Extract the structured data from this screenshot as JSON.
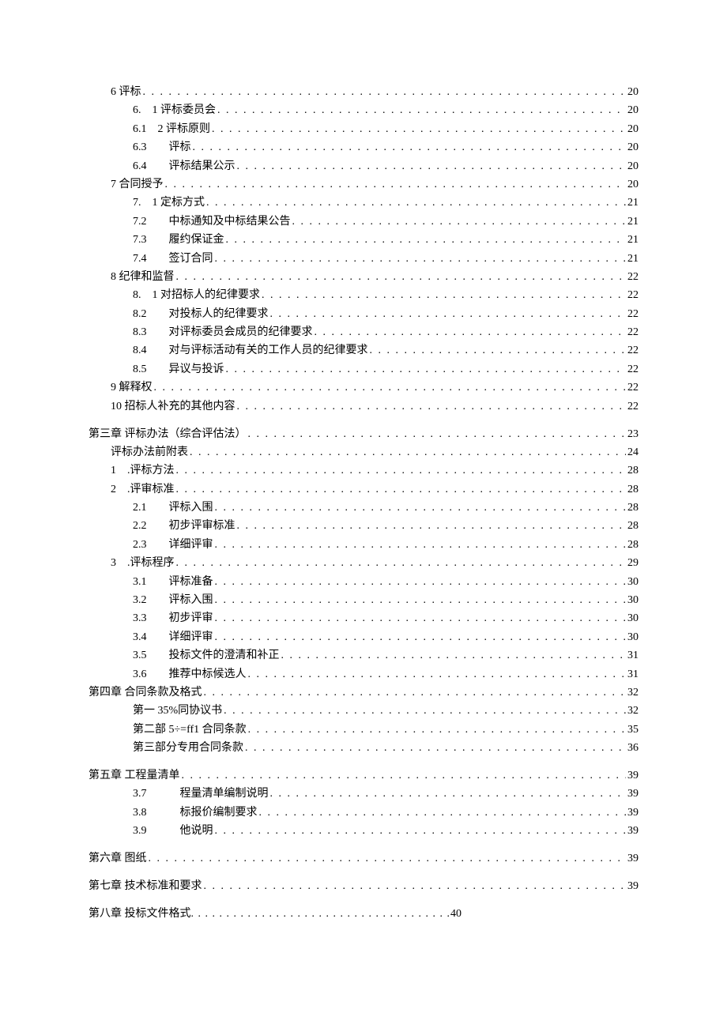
{
  "entries": [
    {
      "level": 2,
      "label": "6 评标",
      "page": "20"
    },
    {
      "level": 3,
      "label": "6.　1 评标委员会",
      "page": "20"
    },
    {
      "level": 3,
      "label": "6.1　2 评标原则",
      "page": "20"
    },
    {
      "level": 3,
      "label": "6.3　　评标",
      "page": "20"
    },
    {
      "level": 3,
      "label": "6.4　　评标结果公示",
      "page": "20"
    },
    {
      "level": 2,
      "label": "7 合同授予",
      "page": "20"
    },
    {
      "level": 3,
      "label": "7.　1 定标方式",
      "page": "21"
    },
    {
      "level": 3,
      "label": "7.2　　中标通知及中标结果公告",
      "page": "21"
    },
    {
      "level": 3,
      "label": "7.3　　履约保证金",
      "page": "21"
    },
    {
      "level": 3,
      "label": "7.4　　签订合同",
      "page": "21"
    },
    {
      "level": 2,
      "label": "8 纪律和监督",
      "page": "22"
    },
    {
      "level": 3,
      "label": "8.　1 对招标人的纪律要求",
      "page": "22"
    },
    {
      "level": 3,
      "label": "8.2　　对投标人的纪律要求",
      "page": "22"
    },
    {
      "level": 3,
      "label": "8.3　　对评标委员会成员的纪律要求",
      "page": "22"
    },
    {
      "level": 3,
      "label": "8.4　　对与评标活动有关的工作人员的纪律要求",
      "page": "22"
    },
    {
      "level": 3,
      "label": "8.5　　异议与投诉",
      "page": "22"
    },
    {
      "level": 2,
      "label": "9 解释权",
      "page": "22"
    },
    {
      "level": 2,
      "label": "10 招标人补充的其他内容",
      "page": "22"
    },
    {
      "level": 1,
      "label": "第三章 评标办法（综合评估法）",
      "page": "23",
      "gap": true
    },
    {
      "level": 2,
      "label": "评标办法前附表",
      "page": "24"
    },
    {
      "level": 2,
      "label": "1　.评标方法",
      "page": "28"
    },
    {
      "level": 2,
      "label": "2　.评审标准",
      "page": "28"
    },
    {
      "level": 3,
      "label": "2.1　　评标入围",
      "page": "28"
    },
    {
      "level": 3,
      "label": "2.2　　初步评审标准",
      "page": "28"
    },
    {
      "level": 3,
      "label": "2.3　　详细评审",
      "page": "28"
    },
    {
      "level": 2,
      "label": "3　.评标程序",
      "page": "29"
    },
    {
      "level": 3,
      "label": "3.1　　评标准备",
      "page": "30"
    },
    {
      "level": 3,
      "label": "3.2　　评标入围",
      "page": "30"
    },
    {
      "level": 3,
      "label": "3.3　　初步评审",
      "page": "30"
    },
    {
      "level": 3,
      "label": "3.4　　详细评审",
      "page": "30"
    },
    {
      "level": 3,
      "label": "3.5　　投标文件的澄清和补正",
      "page": "31"
    },
    {
      "level": 3,
      "label": "3.6　　推荐中标候选人",
      "page": "31"
    },
    {
      "level": 1,
      "label": "第四章 合同条款及格式",
      "page": "32"
    },
    {
      "level": 3,
      "label": "第一 35%同协议书",
      "page": "32"
    },
    {
      "level": 3,
      "label": "第二部 5÷=ff1 合同条款",
      "page": "35"
    },
    {
      "level": 3,
      "label": "第三部分专用合同条款",
      "page": "36"
    },
    {
      "level": 1,
      "label": "第五章 工程量清单",
      "page": "39",
      "gap": true
    },
    {
      "level": 3,
      "label": "3.7　　　程量清单编制说明",
      "page": "39"
    },
    {
      "level": 3,
      "label": "3.8　　　标报价编制要求",
      "page": "39"
    },
    {
      "level": 3,
      "label": "3.9　　　他说明",
      "page": "39"
    },
    {
      "level": 1,
      "label": "第六章 图纸",
      "page": "39",
      "gap": true
    },
    {
      "level": 1,
      "label": "第七章 技术标准和要求",
      "page": "39",
      "gap": true
    },
    {
      "level": 1,
      "label": "第八章 投标文件格式",
      "page": "40",
      "gap": true,
      "short": true
    }
  ]
}
